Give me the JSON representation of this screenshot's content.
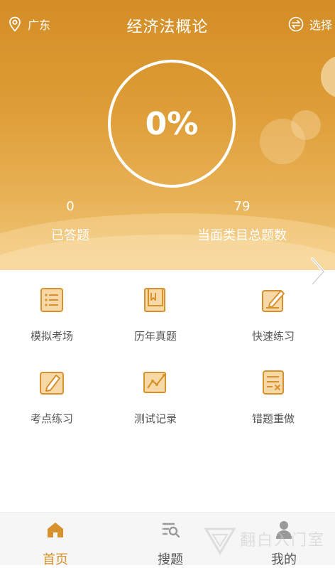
{
  "header": {
    "location": "广东",
    "title": "经济法概论",
    "choose_label": "选择"
  },
  "progress": {
    "percent_text": "0%",
    "answered_count": "0",
    "answered_label": "已答题",
    "total_count": "79",
    "total_label": "当面类目总题数"
  },
  "features": [
    {
      "label": "模拟考场",
      "icon": "list-doc-icon"
    },
    {
      "label": "历年真题",
      "icon": "book-icon"
    },
    {
      "label": "快速练习",
      "icon": "edit-icon"
    },
    {
      "label": "考点练习",
      "icon": "pencil-note-icon"
    },
    {
      "label": "测试记录",
      "icon": "chart-icon"
    },
    {
      "label": "错题重做",
      "icon": "wrong-doc-icon"
    }
  ],
  "tabs": [
    {
      "label": "首页",
      "icon": "home-icon",
      "active": true
    },
    {
      "label": "搜题",
      "icon": "search-list-icon",
      "active": false
    },
    {
      "label": "我的",
      "icon": "user-icon",
      "active": false
    }
  ],
  "watermark": "翻白入门室",
  "colors": {
    "accent": "#d8922d",
    "hero_top": "#d48d27",
    "hero_bottom": "#f0c77b",
    "icon_fill": "#f7d9a7"
  }
}
